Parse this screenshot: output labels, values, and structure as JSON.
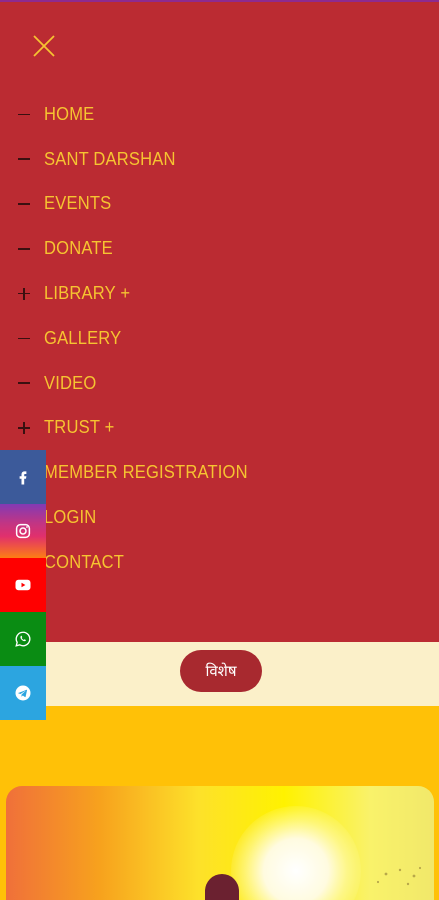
{
  "menu": {
    "close_icon": "close-icon",
    "items": [
      {
        "label": "HOME",
        "sign": "minus"
      },
      {
        "label": "SANT DARSHAN",
        "sign": "minus"
      },
      {
        "label": "EVENTS",
        "sign": "minus"
      },
      {
        "label": "DONATE",
        "sign": "minus"
      },
      {
        "label": "LIBRARY +",
        "sign": "plus"
      },
      {
        "label": "GALLERY",
        "sign": "minus"
      },
      {
        "label": "VIDEO",
        "sign": "minus"
      },
      {
        "label": "TRUST +",
        "sign": "plus"
      },
      {
        "label": "MEMBER REGISTRATION",
        "sign": "none"
      },
      {
        "label": "LOGIN",
        "sign": "none"
      },
      {
        "label": "CONTACT",
        "sign": "none"
      }
    ]
  },
  "social": [
    {
      "icon": "facebook-icon",
      "color": "#3c5a9a"
    },
    {
      "icon": "instagram-icon",
      "color": "#c13584"
    },
    {
      "icon": "youtube-icon",
      "color": "#ff0000"
    },
    {
      "icon": "whatsapp-icon",
      "color": "#0a8c13"
    },
    {
      "icon": "telegram-icon",
      "color": "#2ca5e0"
    }
  ],
  "vishesh": {
    "label": "विशेष"
  },
  "colors": {
    "menu_background": "#bb2b32",
    "menu_text": "#f6c431",
    "page_background": "#ffc107",
    "strip_background": "#fbf0c9",
    "pill_background": "#a8292f"
  }
}
